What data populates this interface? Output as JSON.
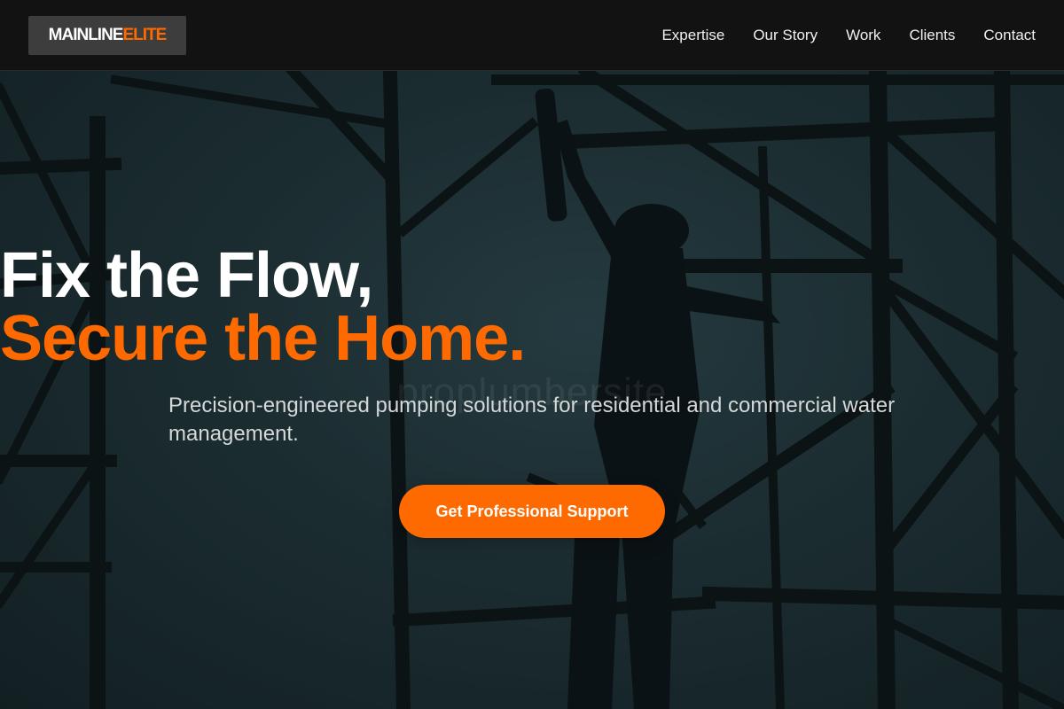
{
  "header": {
    "logo_part1": "MAINLINE",
    "logo_part2": "ELITE",
    "nav": [
      "Expertise",
      "Our Story",
      "Work",
      "Clients",
      "Contact"
    ]
  },
  "hero": {
    "title_line1": "Fix the Flow,",
    "title_line2": "Secure the Home.",
    "subtitle": "Precision-engineered pumping solutions for residential and commercial water management.",
    "watermark": "proplumbersite",
    "cta_label": "Get Professional Support",
    "background_image": "scaffolding-worker-silhouette"
  },
  "colors": {
    "accent": "#ff6a00",
    "header_bg": "#121212",
    "logo_bg": "#3d3d3d"
  }
}
